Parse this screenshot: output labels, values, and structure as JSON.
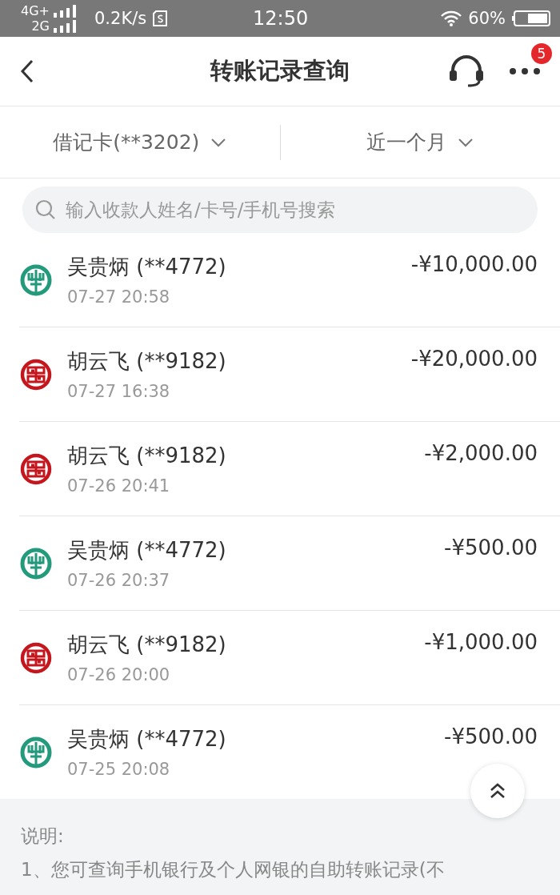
{
  "status_bar": {
    "network_top": "4G+",
    "network_bottom": "2G",
    "speed": "0.2K/s",
    "time": "12:50",
    "battery": "60%"
  },
  "header": {
    "title": "转账记录查询",
    "badge": "5"
  },
  "filters": [
    {
      "label": "借记卡(**3202)"
    },
    {
      "label": "近一个月"
    }
  ],
  "search": {
    "placeholder": "输入收款人姓名/卡号/手机号搜索"
  },
  "records": [
    {
      "kind": "green",
      "name": "吴贵炳 (**4772)",
      "time": "07-27 20:58",
      "amount": "-¥10,000.00"
    },
    {
      "kind": "red",
      "name": "胡云飞 (**9182)",
      "time": "07-27 16:38",
      "amount": "-¥20,000.00"
    },
    {
      "kind": "red",
      "name": "胡云飞 (**9182)",
      "time": "07-26 20:41",
      "amount": "-¥2,000.00"
    },
    {
      "kind": "green",
      "name": "吴贵炳 (**4772)",
      "time": "07-26 20:37",
      "amount": "-¥500.00"
    },
    {
      "kind": "red",
      "name": "胡云飞 (**9182)",
      "time": "07-26 20:00",
      "amount": "-¥1,000.00"
    },
    {
      "kind": "green",
      "name": "吴贵炳 (**4772)",
      "time": "07-25 20:08",
      "amount": "-¥500.00"
    }
  ],
  "notes": {
    "heading": "说明:",
    "lines": [
      "1、您可查询手机银行及个人网银的自助转账记录(不"
    ]
  }
}
